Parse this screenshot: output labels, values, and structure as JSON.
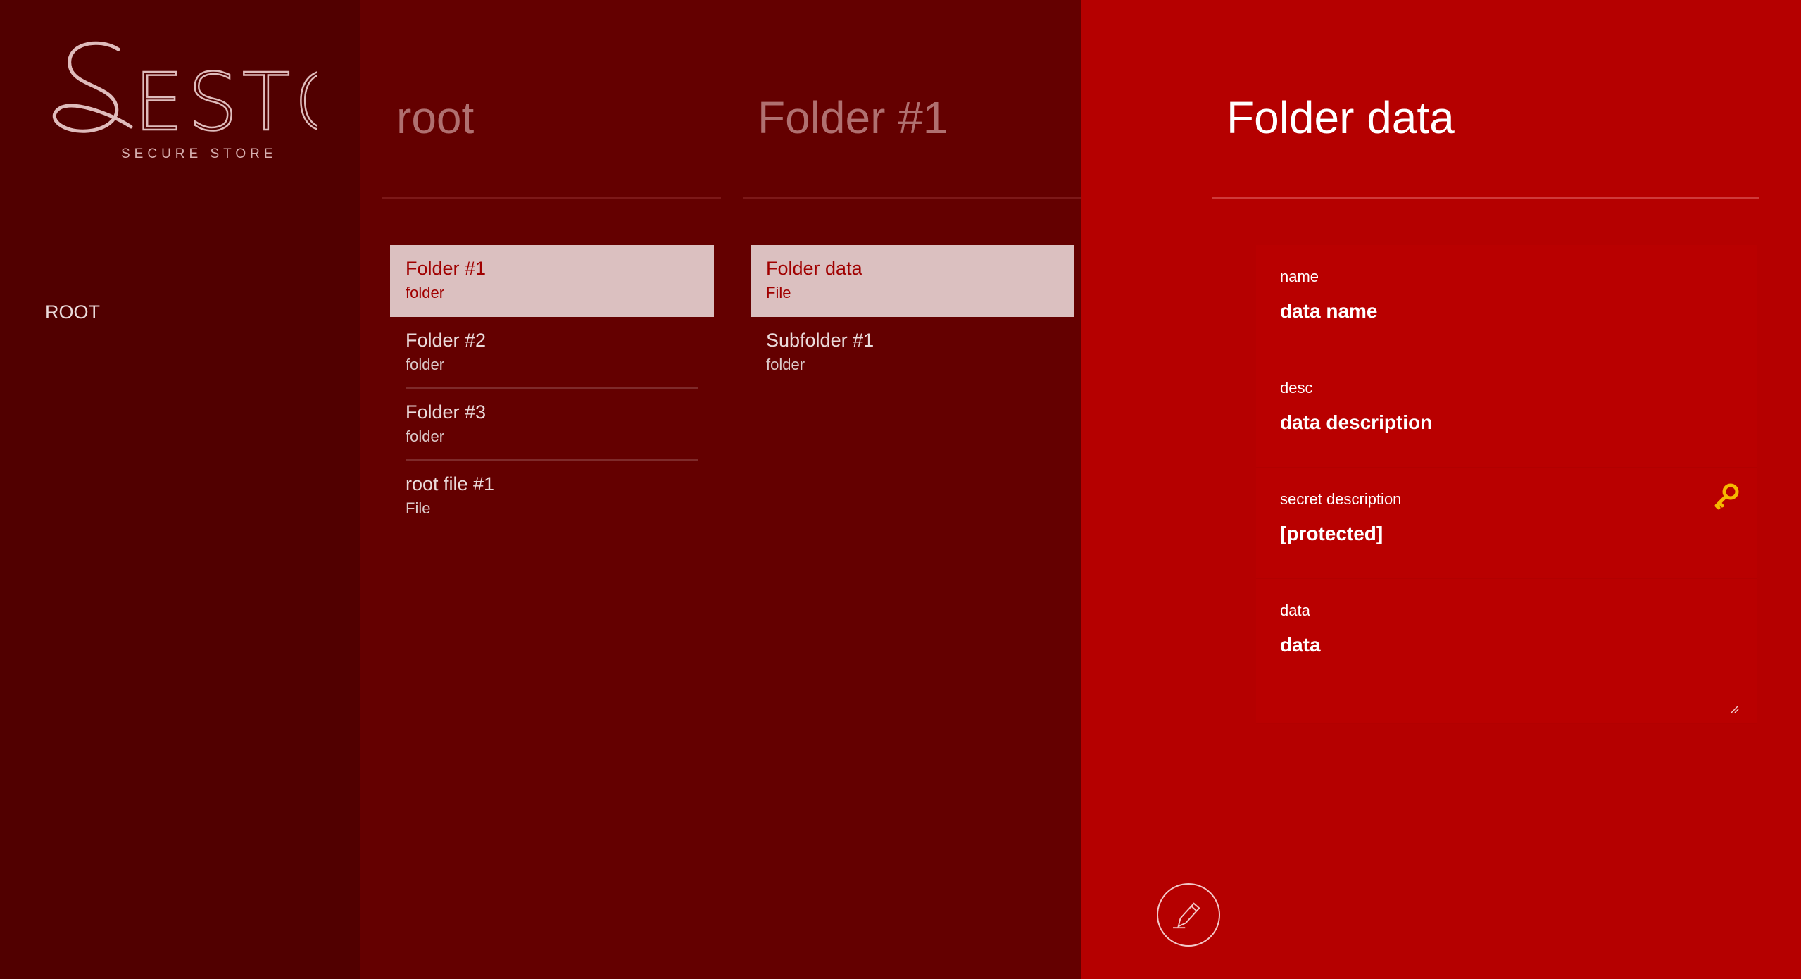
{
  "brand": {
    "logo_text": "SESTO",
    "tagline": "SECURE STORE"
  },
  "sidebar": {
    "items": [
      {
        "label": "ROOT"
      }
    ]
  },
  "columns": [
    {
      "title": "root",
      "items": [
        {
          "name": "Folder #1",
          "type": "folder",
          "selected": true
        },
        {
          "name": "Folder #2",
          "type": "folder"
        },
        {
          "name": "Folder #3",
          "type": "folder"
        },
        {
          "name": "root file #1",
          "type": "File"
        }
      ]
    },
    {
      "title": "Folder #1",
      "items": [
        {
          "name": "Folder data",
          "type": "File",
          "selected": true
        },
        {
          "name": "Subfolder #1",
          "type": "folder"
        }
      ]
    }
  ],
  "detail": {
    "title": "Folder data",
    "fields": [
      {
        "label": "name",
        "value": "data name"
      },
      {
        "label": "desc",
        "value": "data description"
      },
      {
        "label": "secret description",
        "value": "[protected]"
      },
      {
        "label": "data",
        "value": "data"
      }
    ]
  },
  "icons": {
    "key": "key-icon",
    "edit": "pencil-icon",
    "resize": "resize-grip-icon"
  },
  "colors": {
    "sidebar_bg": "#510000",
    "column_bg": "#640000",
    "detail_bg": "#b50000",
    "selected_bg": "#dbc0c0",
    "key_accent": "#f5b800"
  }
}
